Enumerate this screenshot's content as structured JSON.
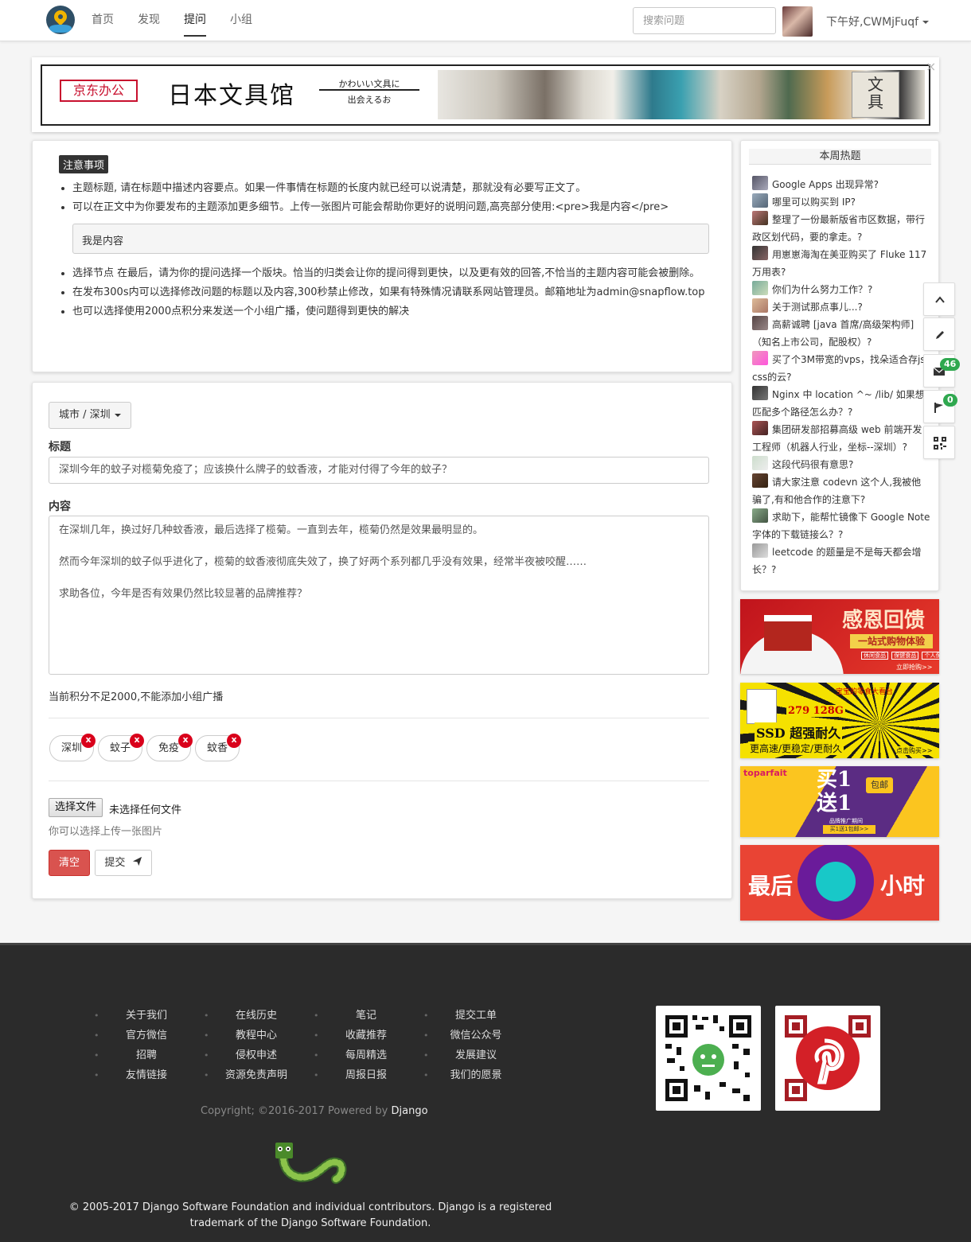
{
  "nav": {
    "links": [
      "首页",
      "发现",
      "提问",
      "小组"
    ],
    "active": "提问",
    "search_placeholder": "搜索问题",
    "greeting": "下午好,CWMjFuqf"
  },
  "banner": {
    "jd_label": "京东办公",
    "title": "日本文具馆",
    "sub1": "かわいい文具に",
    "sub2": "出会えるお",
    "close": "×"
  },
  "notice": {
    "label": "注意事项",
    "items": [
      "主题标题, 请在标题中描述内容要点。如果一件事情在标题的长度内就已经可以说清楚，那就没有必要写正文了。",
      "可以在正文中为你要发布的主题添加更多细节。上传一张图片可能会帮助你更好的说明问题,高亮部分使用:<pre>我是内容</pre>",
      "选择节点 在最后，请为你的提问选择一个版块。恰当的归类会让你的提问得到更快，以及更有效的回答,不恰当的主题内容可能会被删除。",
      "在发布300s内可以选择修改问题的标题以及内容,300秒禁止修改，如果有特殊情况请联系网站管理员。邮箱地址为admin@snapflow.top",
      "也可以选择使用2000点积分来发送一个小组广播，使问题得到更快的解决"
    ],
    "pre_example": "我是内容"
  },
  "form": {
    "city_button": "城市 / 深圳",
    "title_label": "标题",
    "title_value": "深圳今年的蚊子对榄菊免疫了；应该换什么牌子的蚊香液，才能对付得了今年的蚊子？",
    "content_label": "内容",
    "content_lines": [
      "在深圳几年，换过好几种蚊香液，最后选择了榄菊。一直到去年，榄菊仍然是效果最明显的。",
      "然而今年深圳的蚊子似乎进化了，榄菊的蚊香液彻底失效了，换了好两个系列都几乎没有效果，经常半夜被咬醒……",
      "求助各位，今年是否有效果仍然比较显著的品牌推荐？"
    ],
    "points_hint": "当前积分不足2000,不能添加小组广播",
    "tags": [
      "深圳",
      "蚊子",
      "免疫",
      "蚊香"
    ],
    "tag_remove": "x",
    "file_button": "选择文件",
    "file_none": "未选择任何文件",
    "file_hint": "你可以选择上传一张图片",
    "clear_button": "清空",
    "submit_button": "提交"
  },
  "sidebar": {
    "title": "本周热题",
    "hot": [
      "Google Apps 出现异常?",
      "哪里可以购买到 IP?",
      "整理了一份最新版省市区数据，带行政区划代码，要的拿走。?",
      "用崽崽海淘在美亚购买了 Fluke 117 万用表?",
      "你们为什么努力工作？?",
      "关于测试那点事儿...?",
      "高薪诚聘 [java 首席/高级架构师]（知名上市公司，配股权）?",
      "买了个3M带宽的vps，找朵适合存js,css的云?",
      "Nginx 中 location ^~ /lib/ 如果想匹配多个路径怎么办？?",
      "集团研发部招募高级 web 前端开发工程师（机器人行业，坐标--深圳）?",
      "这段代码很有意思?",
      "请大家注意 codevn 这个人,我被他骗了,有和他合作的注意下?",
      "求助下，能帮忙镜像下 Google Note 字体的下载链接么？?",
      "leetcode 的题量是不是每天都会增长？?"
    ],
    "ads": {
      "ad1_title": "感恩回馈",
      "ad1_sub": "一站式购物体验",
      "ad1_tags": [
        "休闲食品",
        "保健食品",
        "个人保健"
      ],
      "ad1_cta": "立即抢购>>",
      "ad2_top": "宝宝的零食大看台",
      "ad2_price": "279 128G",
      "ad2_title": "SSD 超强耐久",
      "ad2_sub": "更高速/更稳定/更耐久",
      "ad2_cta": "点击购买>>",
      "ad3_brand": "toparfait",
      "ad3_title": "买1送1",
      "ad3_badge": "包邮",
      "ad3_sub": "品牌推广期间",
      "ad3_cta": "买1送1包邮>>",
      "ad4_left": "最后",
      "ad4_right": "小时"
    }
  },
  "float": {
    "mail_count": "46",
    "flag_count": "0"
  },
  "footer": {
    "columns": [
      [
        "关于我们",
        "官方微信",
        "招聘",
        "友情链接"
      ],
      [
        "在线历史",
        "教程中心",
        "侵权申述",
        "资源免责声明"
      ],
      [
        "笔记",
        "收藏推荐",
        "每周精选",
        "周报日报"
      ],
      [
        "提交工单",
        "微信公众号",
        "发展建议",
        "我们的愿景"
      ]
    ],
    "copyright_prefix": "Copyright; ©2016-2017 Powered by",
    "copyright_link": "Django",
    "legal": "© 2005-2017 Django Software Foundation and individual contributors. Django is a registered trademark of the Django Software Foundation."
  }
}
